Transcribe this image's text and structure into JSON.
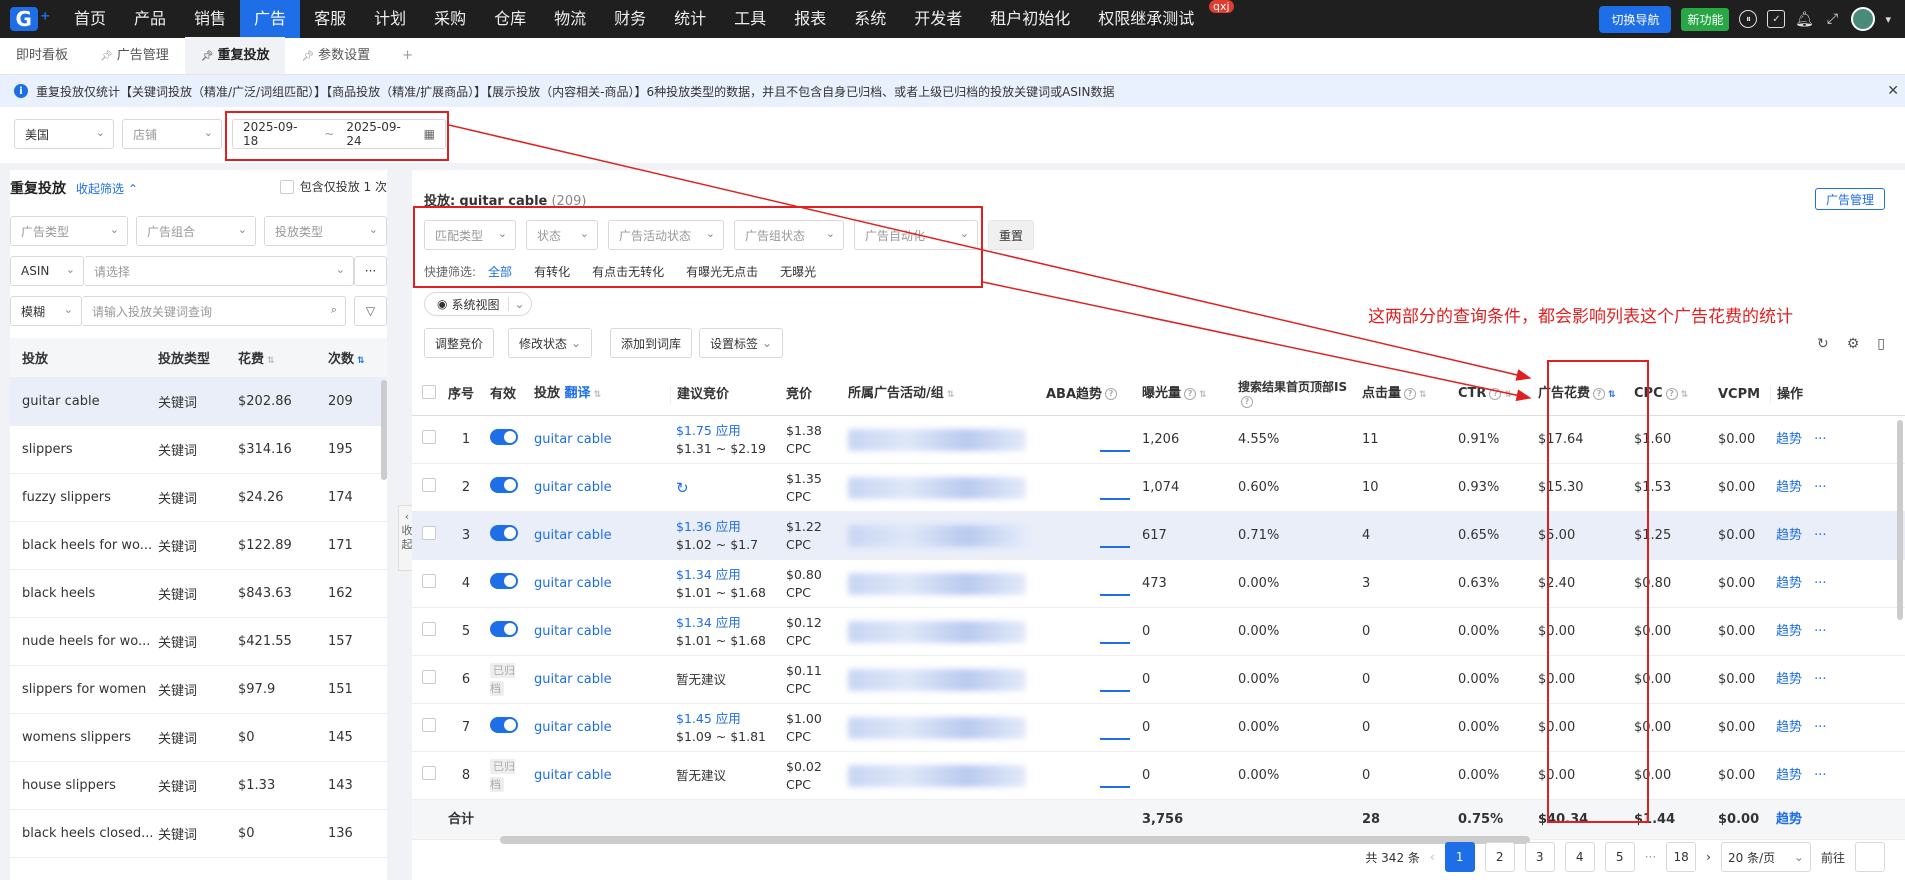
{
  "nav": {
    "logo": "G",
    "items": [
      "首页",
      "产品",
      "销售",
      "广告",
      "客服",
      "计划",
      "采购",
      "仓库",
      "物流",
      "财务",
      "统计",
      "工具",
      "报表",
      "系统",
      "开发者",
      "租户初始化",
      "权限继承测试"
    ],
    "active_index": 3,
    "switch_nav": "切换导航",
    "new_feature": "新功能",
    "user_badge": "qxj"
  },
  "tabs": [
    {
      "label": "即时看板"
    },
    {
      "label": "广告管理"
    },
    {
      "label": "重复投放"
    },
    {
      "label": "参数设置"
    },
    {
      "label": "+"
    }
  ],
  "notice": {
    "text": "重复投放仅统计【关键词投放（精准/广泛/词组匹配）】【商品投放（精准/扩展商品）】【展示投放（内容相关-商品）】6种投放类型的数据，并且不包含自身已归档、或者上级已归档的投放关键词或ASIN数据"
  },
  "filters": {
    "country": "美国",
    "shop_placeholder": "店铺",
    "date_start": "2025-09-18",
    "date_sep": "~",
    "date_end": "2025-09-24"
  },
  "left": {
    "title": "重复投放",
    "collapse_label": "收起筛选",
    "include_label": "包含仅投放 1 次",
    "ad_type_ph": "广告类型",
    "ad_group_ph": "广告组合",
    "target_type_ph": "投放类型",
    "asin_label": "ASIN",
    "asin_select_ph": "请选择",
    "more": "···",
    "fuzzy_label": "模糊",
    "search_ph": "请输入投放关键词查询",
    "headers": [
      "投放",
      "投放类型",
      "花费",
      "次数"
    ],
    "rows": [
      {
        "name": "guitar cable",
        "type": "关键词",
        "cost": "$202.86",
        "count": "209"
      },
      {
        "name": "slippers",
        "type": "关键词",
        "cost": "$314.16",
        "count": "195"
      },
      {
        "name": "fuzzy slippers",
        "type": "关键词",
        "cost": "$24.26",
        "count": "174"
      },
      {
        "name": "black heels for wo...",
        "type": "关键词",
        "cost": "$122.89",
        "count": "171"
      },
      {
        "name": "black heels",
        "type": "关键词",
        "cost": "$843.63",
        "count": "162"
      },
      {
        "name": "nude heels for wo...",
        "type": "关键词",
        "cost": "$421.55",
        "count": "157"
      },
      {
        "name": "slippers for women",
        "type": "关键词",
        "cost": "$97.9",
        "count": "151"
      },
      {
        "name": "womens slippers",
        "type": "关键词",
        "cost": "$0",
        "count": "145"
      },
      {
        "name": "house slippers",
        "type": "关键词",
        "cost": "$1.33",
        "count": "143"
      },
      {
        "name": "black heels closed...",
        "type": "关键词",
        "cost": "$0",
        "count": "136"
      }
    ],
    "collapse_handle": "收起"
  },
  "main": {
    "target_label": "投放:",
    "target_name": "guitar cable",
    "target_count": "(209)",
    "ad_manage_btn": "广告管理",
    "filter_match": "匹配类型",
    "filter_status": "状态",
    "filter_campaign_status": "广告活动状态",
    "filter_group_status": "广告组状态",
    "filter_auto": "广告自动化",
    "reset": "重置",
    "quick_label": "快捷筛选:",
    "quick_items": [
      "全部",
      "有转化",
      "有点击无转化",
      "有曝光无点击",
      "无曝光"
    ],
    "view_label": "系统视图",
    "actions": [
      "调整竞价",
      "修改状态",
      "添加到词库",
      "设置标签"
    ],
    "annotation": "这两部分的查询条件，都会影响列表这个广告花费的统计",
    "headers": {
      "idx": "序号",
      "valid": "有效",
      "target": "投放",
      "translate": "翻译",
      "suggest": "建议竞价",
      "bid": "竞价",
      "campaign": "所属广告活动/组",
      "aba": "ABA趋势",
      "impr": "曝光量",
      "search_is": "搜索结果首页顶部IS",
      "clicks": "点击量",
      "ctr": "CTR",
      "spend": "广告花费",
      "cpc": "CPC",
      "vcpm": "VCPM",
      "op": "操作"
    },
    "rows": [
      {
        "idx": "1",
        "on": true,
        "target": "guitar cable",
        "sug": "$1.75",
        "apply": "应用",
        "range": "$1.31 ~ $2.19",
        "bid": "$1.38",
        "bidtype": "CPC",
        "impr": "1,206",
        "is": "4.55%",
        "clicks": "11",
        "ctr": "0.91%",
        "spend": "$17.64",
        "cpc": "$1.60",
        "vcpm": "$0.00",
        "trend": "趋势",
        "more": "···"
      },
      {
        "idx": "2",
        "on": true,
        "target": "guitar cable",
        "sug": "",
        "apply": "",
        "range": "↻",
        "bid": "$1.35",
        "bidtype": "CPC",
        "impr": "1,074",
        "is": "0.60%",
        "clicks": "10",
        "ctr": "0.93%",
        "spend": "$15.30",
        "cpc": "$1.53",
        "vcpm": "$0.00",
        "trend": "趋势",
        "more": "···"
      },
      {
        "idx": "3",
        "on": true,
        "target": "guitar cable",
        "sug": "$1.36",
        "apply": "应用",
        "range": "$1.02 ~ $1.7",
        "bid": "$1.22",
        "bidtype": "CPC",
        "impr": "617",
        "is": "0.71%",
        "clicks": "4",
        "ctr": "0.65%",
        "spend": "$5.00",
        "cpc": "$1.25",
        "vcpm": "$0.00",
        "trend": "趋势",
        "more": "···"
      },
      {
        "idx": "4",
        "on": true,
        "target": "guitar cable",
        "sug": "$1.34",
        "apply": "应用",
        "range": "$1.01 ~ $1.68",
        "bid": "$0.80",
        "bidtype": "CPC",
        "impr": "473",
        "is": "0.00%",
        "clicks": "3",
        "ctr": "0.63%",
        "spend": "$2.40",
        "cpc": "$0.80",
        "vcpm": "$0.00",
        "trend": "趋势",
        "more": "···"
      },
      {
        "idx": "5",
        "on": true,
        "target": "guitar cable",
        "sug": "$1.34",
        "apply": "应用",
        "range": "$1.01 ~ $1.68",
        "bid": "$0.12",
        "bidtype": "CPC",
        "impr": "0",
        "is": "0.00%",
        "clicks": "0",
        "ctr": "0.00%",
        "spend": "$0.00",
        "cpc": "$0.00",
        "vcpm": "$0.00",
        "trend": "趋势",
        "more": "···"
      },
      {
        "idx": "6",
        "on": false,
        "archived": "已归档",
        "target": "guitar cable",
        "sug": "暂无建议",
        "apply": "",
        "range": "",
        "bid": "$0.11",
        "bidtype": "CPC",
        "impr": "0",
        "is": "0.00%",
        "clicks": "0",
        "ctr": "0.00%",
        "spend": "$0.00",
        "cpc": "$0.00",
        "vcpm": "$0.00",
        "trend": "趋势",
        "more": "···"
      },
      {
        "idx": "7",
        "on": true,
        "target": "guitar cable",
        "sug": "$1.45",
        "apply": "应用",
        "range": "$1.09 ~ $1.81",
        "bid": "$1.00",
        "bidtype": "CPC",
        "impr": "0",
        "is": "0.00%",
        "clicks": "0",
        "ctr": "0.00%",
        "spend": "$0.00",
        "cpc": "$0.00",
        "vcpm": "$0.00",
        "trend": "趋势",
        "more": "···"
      },
      {
        "idx": "8",
        "on": false,
        "archived": "已归档",
        "target": "guitar cable",
        "sug": "暂无建议",
        "apply": "",
        "range": "",
        "bid": "$0.02",
        "bidtype": "CPC",
        "impr": "0",
        "is": "0.00%",
        "clicks": "0",
        "ctr": "0.00%",
        "spend": "$0.00",
        "cpc": "$0.00",
        "vcpm": "$0.00",
        "trend": "趋势",
        "more": "···"
      }
    ],
    "total": {
      "label": "合计",
      "impr": "3,756",
      "clicks": "28",
      "ctr": "0.75%",
      "spend": "$40.34",
      "cpc": "$1.44",
      "vcpm": "$0.00",
      "trend": "趋势"
    },
    "pager": {
      "total": "共 342 条",
      "pages": [
        "1",
        "2",
        "3",
        "4",
        "5",
        "···",
        "18"
      ],
      "current": "1",
      "size": "20 条/页",
      "goto": "前往"
    }
  }
}
